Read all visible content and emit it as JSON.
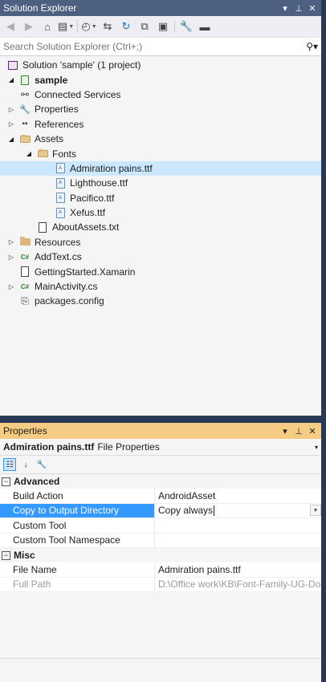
{
  "solution_explorer": {
    "title": "Solution Explorer",
    "title_buttons": [
      "▾",
      "⊥",
      "✕"
    ],
    "search_placeholder": "Search Solution Explorer (Ctrl+;)",
    "tree": [
      {
        "label": "Solution 'sample' (1 project)",
        "icon": "solution-icon",
        "level": 0,
        "expander": ""
      },
      {
        "label": "sample",
        "icon": "project-icon",
        "level": 0,
        "expander": "◢",
        "bold": true
      },
      {
        "label": "Connected Services",
        "icon": "connected-services-icon",
        "level": 1,
        "expander": ""
      },
      {
        "label": "Properties",
        "icon": "wrench-icon",
        "level": 1,
        "expander": "▷"
      },
      {
        "label": "References",
        "icon": "references-icon",
        "level": 1,
        "expander": "▷"
      },
      {
        "label": "Assets",
        "icon": "folder-open-icon",
        "level": 1,
        "expander": "◢"
      },
      {
        "label": "Fonts",
        "icon": "folder-open-icon",
        "level": 2,
        "expander": "◢"
      },
      {
        "label": "Admiration pains.ttf",
        "icon": "font-file-icon",
        "level": 3,
        "expander": "",
        "selected": true
      },
      {
        "label": "Lighthouse.ttf",
        "icon": "font-file-icon",
        "level": 3,
        "expander": ""
      },
      {
        "label": "Pacifico.ttf",
        "icon": "font-file-icon",
        "level": 3,
        "expander": ""
      },
      {
        "label": "Xefus.ttf",
        "icon": "font-file-icon",
        "level": 3,
        "expander": ""
      },
      {
        "label": "AboutAssets.txt",
        "icon": "text-file-icon",
        "level": 2,
        "expander": ""
      },
      {
        "label": "Resources",
        "icon": "folder-icon",
        "level": 1,
        "expander": "▷"
      },
      {
        "label": "AddText.cs",
        "icon": "csharp-file-icon",
        "level": 1,
        "expander": "▷"
      },
      {
        "label": "GettingStarted.Xamarin",
        "icon": "file-icon",
        "level": 1,
        "expander": ""
      },
      {
        "label": "MainActivity.cs",
        "icon": "csharp-file-icon",
        "level": 1,
        "expander": "▷"
      },
      {
        "label": "packages.config",
        "icon": "config-file-icon",
        "level": 1,
        "expander": ""
      }
    ]
  },
  "properties": {
    "title": "Properties",
    "title_buttons": [
      "▾",
      "⊥",
      "✕"
    ],
    "object_name": "Admiration pains.ttf",
    "object_type": "File Properties",
    "categories": [
      {
        "name": "Advanced",
        "toggle": "⊟",
        "rows": [
          {
            "name": "Build Action",
            "value": "AndroidAsset"
          },
          {
            "name": "Copy to Output Directory",
            "value": "Copy always",
            "selected": true,
            "dropdown": true
          },
          {
            "name": "Custom Tool",
            "value": ""
          },
          {
            "name": "Custom Tool Namespace",
            "value": ""
          }
        ]
      },
      {
        "name": "Misc",
        "toggle": "⊟",
        "rows": [
          {
            "name": "File Name",
            "value": "Admiration pains.ttf"
          },
          {
            "name": "Full Path",
            "value": "D:\\Office work\\KB\\Font-Family-UG-Do",
            "readonly": true
          }
        ]
      }
    ]
  },
  "colors": {
    "background": "#293955",
    "active_title": "#f5cc84",
    "inactive_title": "#4d6082",
    "selection": "#cce8ff",
    "grid_selection": "#3399ff"
  }
}
